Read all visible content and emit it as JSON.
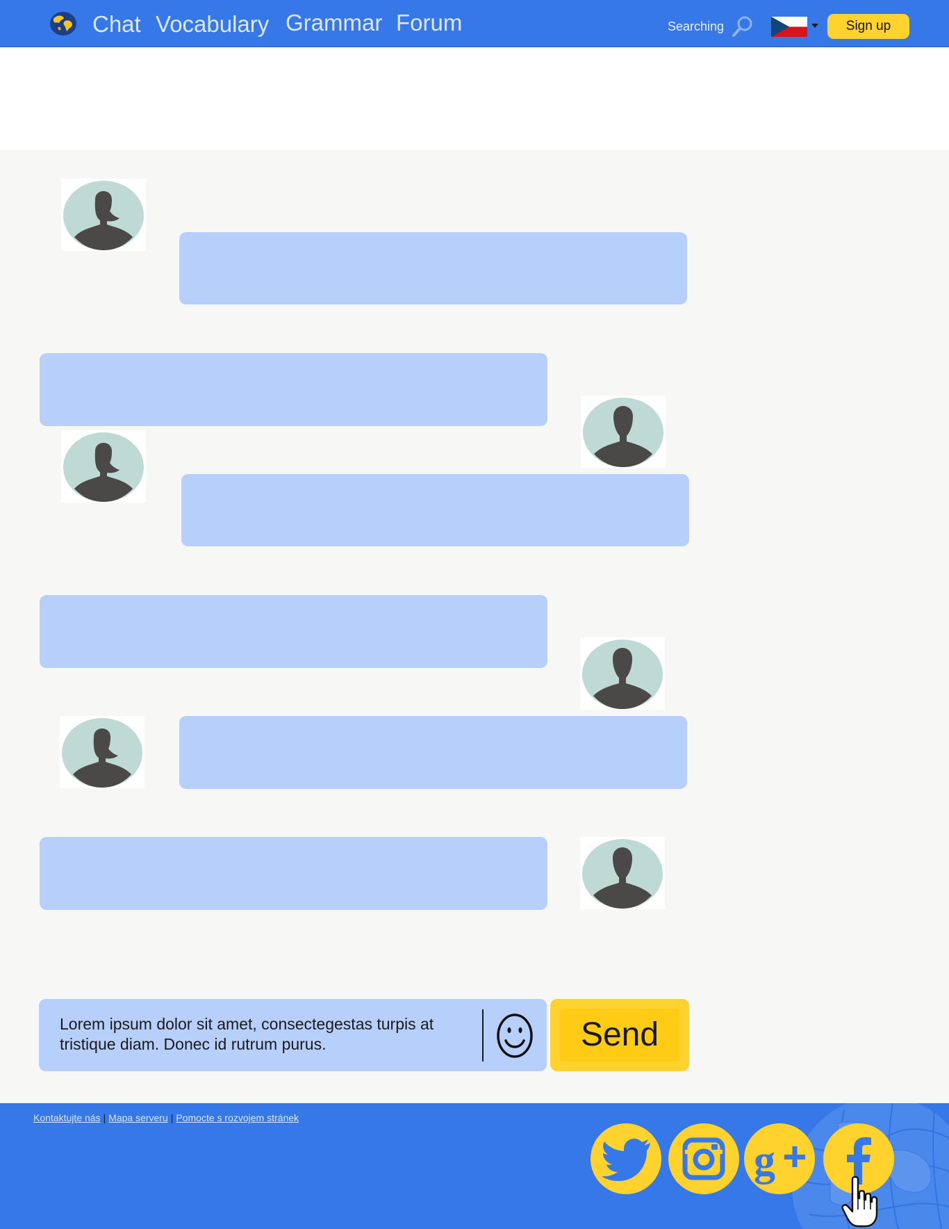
{
  "header": {
    "nav": [
      "Chat",
      "Vocabulary",
      "Grammar",
      "Forum"
    ],
    "search_label": "Searching",
    "language": "Czech",
    "signup_label": "Sign up"
  },
  "chat": {
    "messages": [
      {
        "side": "left",
        "avatar": "female-avatar",
        "text": ""
      },
      {
        "side": "right",
        "avatar": "male-avatar",
        "text": ""
      },
      {
        "side": "left",
        "avatar": "female-avatar",
        "text": ""
      },
      {
        "side": "right",
        "avatar": "male-avatar",
        "text": ""
      },
      {
        "side": "left",
        "avatar": "female-avatar",
        "text": ""
      },
      {
        "side": "right",
        "avatar": "male-avatar",
        "text": ""
      }
    ]
  },
  "composer": {
    "value": "Lorem ipsum dolor sit amet, consectegestas turpis at tristique diam. Donec id rutrum purus.",
    "emoji_icon": "smiley-icon",
    "send_label": "Send"
  },
  "footer": {
    "links": [
      "Kontaktujte nás",
      "Mapa serveru",
      "Pomocte s rozvojem stránek"
    ],
    "separator": "|",
    "social": [
      "twitter-icon",
      "instagram-icon",
      "google-plus-icon",
      "facebook-icon"
    ]
  },
  "colors": {
    "brand_blue": "#3678e8",
    "accent_yellow": "#ffd22e",
    "bubble_blue": "#b7cffb",
    "avatar_bg": "#bfd9d4",
    "silhouette": "#4a4947"
  }
}
